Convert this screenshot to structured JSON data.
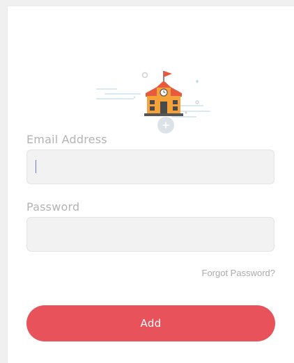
{
  "form": {
    "email_label": "Email Address",
    "email_value": "",
    "email_placeholder": "",
    "password_label": "Password",
    "password_value": "",
    "password_placeholder": "",
    "forgot_label": "Forgot Password?",
    "add_label": "Add"
  },
  "illustration": {
    "icon": "school-building-icon",
    "badge_icon": "plus-icon"
  },
  "colors": {
    "accent": "#e8525a",
    "input_bg": "#f2f2f2",
    "label": "#b3b3b3",
    "link": "#aaaaaa",
    "roof": "#e85a3e",
    "wall": "#f6a23a"
  }
}
